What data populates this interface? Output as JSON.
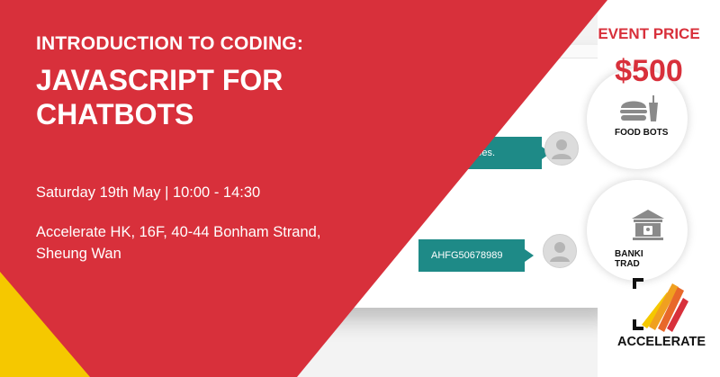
{
  "header": {
    "subtitle": "INTRODUCTION TO CODING:",
    "title": "JAVASCRIPT FOR CHATBOTS"
  },
  "event": {
    "date_time": "Saturday 19th May | 10:00 - 14:30",
    "venue": "Accelerate HK, 16F, 40-44 Bonham Strand, Sheung Wan",
    "price_label": "EVENT PRICE",
    "price": "$500"
  },
  "chat_mockup": {
    "message_1": "pair of shoes.",
    "message_2": "AHFG50678989"
  },
  "categories": [
    {
      "label": "FOOD BOTS",
      "icon": "burger-icon"
    },
    {
      "label": "BANKI TRAD",
      "icon": "bank-icon"
    }
  ],
  "brand": {
    "name": "ACCELERATE",
    "logo": "accelerate-logo"
  },
  "colors": {
    "red": "#d8303b",
    "yellow": "#f5c800",
    "teal": "#1e8a87",
    "white": "#ffffff"
  }
}
